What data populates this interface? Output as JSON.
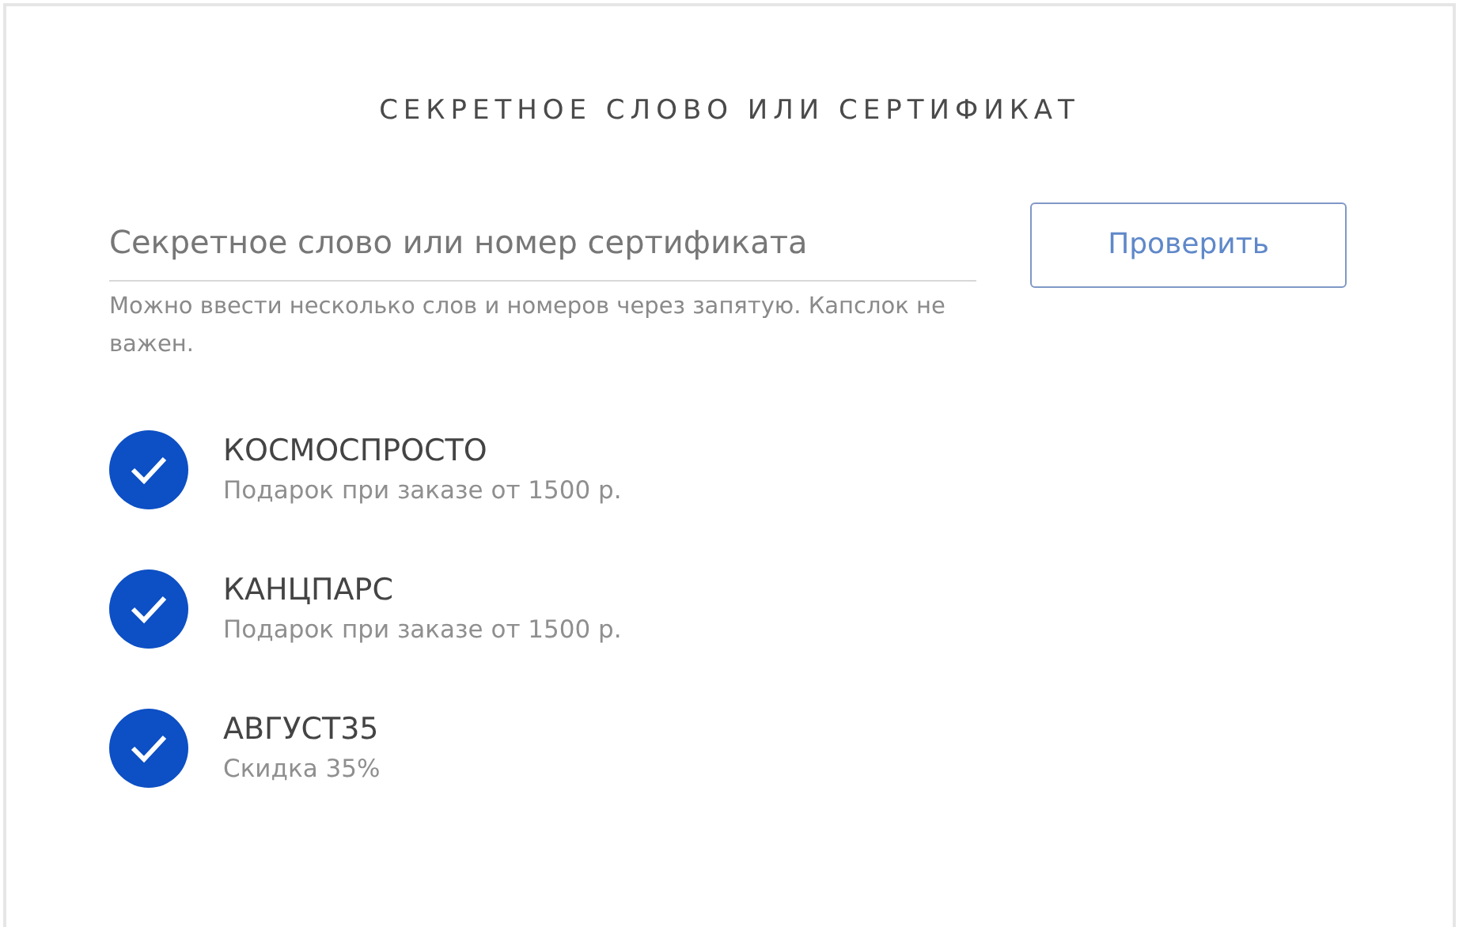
{
  "title": "СЕКРЕТНОЕ СЛОВО ИЛИ СЕРТИФИКАТ",
  "code_field": {
    "placeholder": "Секретное слово или номер сертификата",
    "hint": "Можно ввести несколько слов и номеров через запятую. Капслок не важен."
  },
  "check_button": "Проверить",
  "codes": [
    {
      "code": "КОСМОСПРОСТО",
      "description": "Подарок при заказе от 1500 р.",
      "accepted": true
    },
    {
      "code": "КАНЦПАРС",
      "description": "Подарок при заказе от 1500 р.",
      "accepted": true
    },
    {
      "code": "АВГУСТ35",
      "description": "Скидка 35%",
      "accepted": true
    }
  ]
}
